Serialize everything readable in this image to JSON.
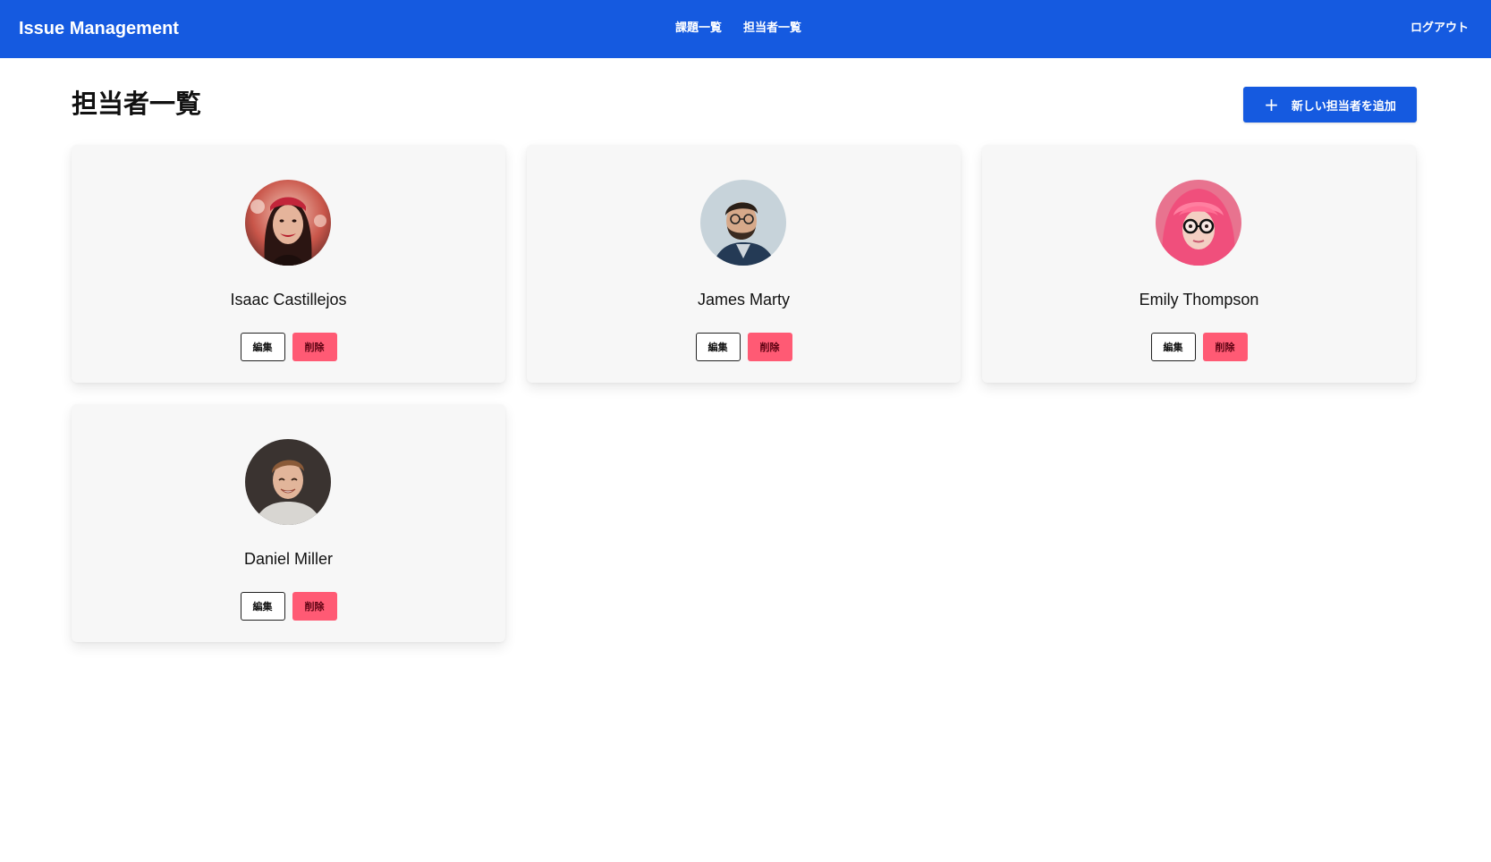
{
  "app": {
    "title": "Issue Management"
  },
  "nav": {
    "links": [
      {
        "label": "課題一覧"
      },
      {
        "label": "担当者一覧"
      }
    ],
    "logout_label": "ログアウト"
  },
  "page": {
    "title": "担当者一覧",
    "add_button_label": "新しい担当者を追加",
    "add_icon": "plus-icon"
  },
  "members": [
    {
      "name": "Isaac Castillejos",
      "edit_label": "編集",
      "delete_label": "削除",
      "avatar": "photo-woman-red-headband"
    },
    {
      "name": "James Marty",
      "edit_label": "編集",
      "delete_label": "削除",
      "avatar": "photo-man-beard-glasses"
    },
    {
      "name": "Emily Thompson",
      "edit_label": "編集",
      "delete_label": "削除",
      "avatar": "photo-woman-pink-hair-glasses"
    },
    {
      "name": "Daniel Miller",
      "edit_label": "編集",
      "delete_label": "削除",
      "avatar": "photo-man-smiling-grey-shirt"
    }
  ],
  "colors": {
    "primary": "#155ae0",
    "danger": "#ff5a74",
    "card_background": "#f7f7f7"
  }
}
